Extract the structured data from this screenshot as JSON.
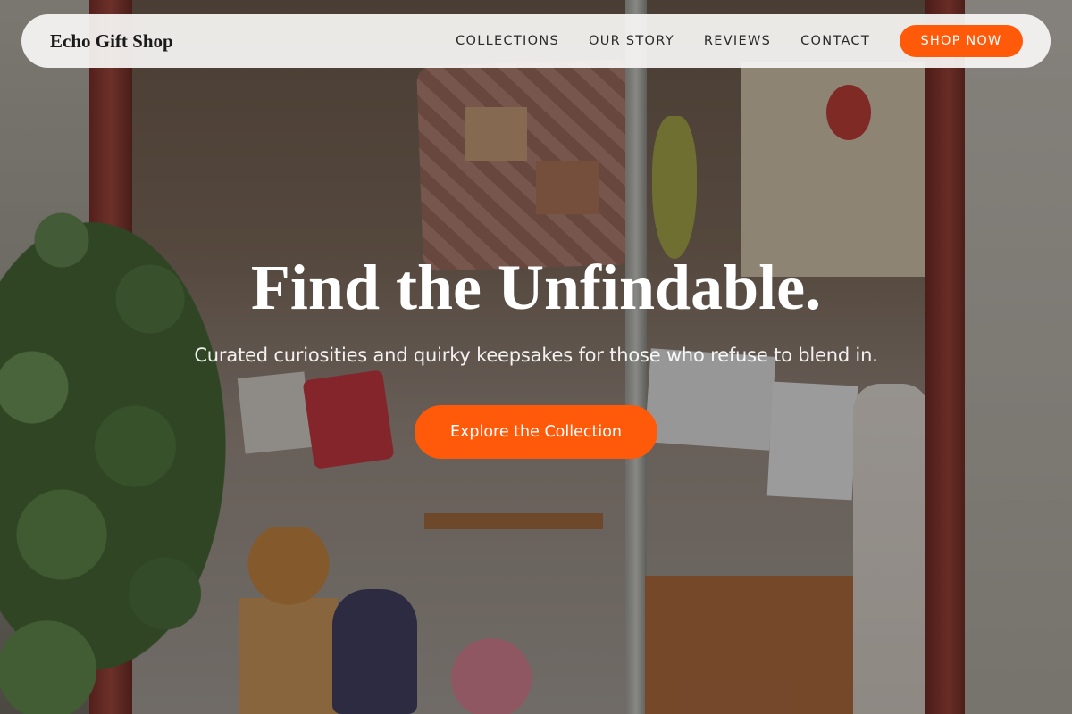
{
  "nav": {
    "logo": "Echo Gift Shop",
    "links": [
      "COLLECTIONS",
      "OUR STORY",
      "REVIEWS",
      "CONTACT"
    ],
    "cta_label": "SHOP NOW"
  },
  "hero": {
    "title": "Find the Unfindable.",
    "subtitle": "Curated curiosities and quirky keepsakes for those who refuse to blend in.",
    "cta_label": "Explore the Collection"
  },
  "colors": {
    "accent": "#FF5A0A",
    "nav_bg": "#F8F6F4",
    "text_dark": "#1A1A1A",
    "hero_text": "#FFFFFF"
  }
}
